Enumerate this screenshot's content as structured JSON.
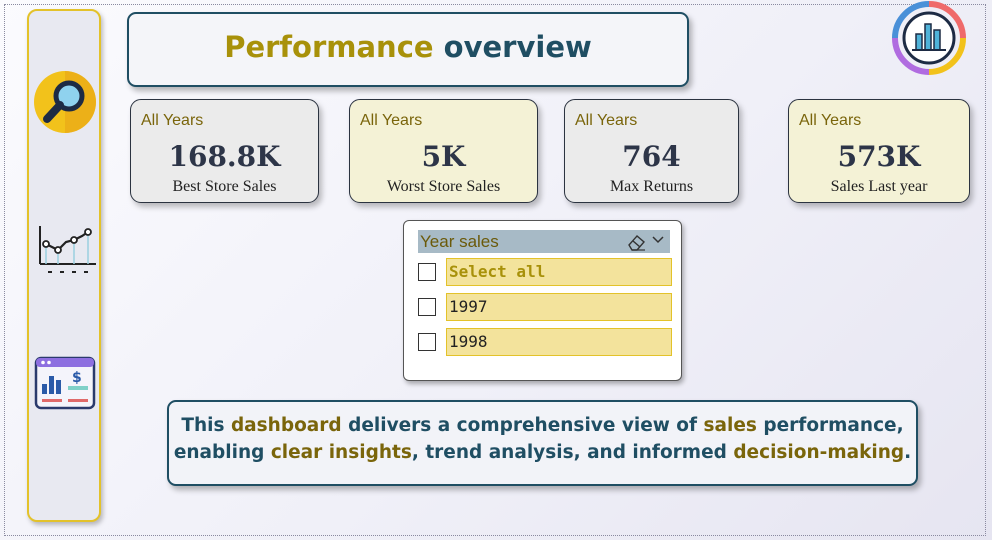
{
  "title": {
    "part1": "Performance",
    "part2": "overview"
  },
  "sidebar": {
    "items": [
      {
        "name": "search",
        "icon": "magnifier-icon"
      },
      {
        "name": "trend",
        "icon": "trend-chart-icon"
      },
      {
        "name": "dashboard",
        "icon": "dashboard-icon"
      }
    ]
  },
  "logo": {
    "icon": "analytics-logo-icon"
  },
  "kpis": [
    {
      "label": "All Years",
      "value": "168.8K",
      "caption": "Best Store Sales",
      "style": "grey"
    },
    {
      "label": "All Years",
      "value": "5K",
      "caption": "Worst Store Sales",
      "style": "cream"
    },
    {
      "label": "All Years",
      "value": "764",
      "caption": "Max Returns",
      "style": "grey"
    },
    {
      "label": "All Years",
      "value": "573K",
      "caption": "Sales Last year",
      "style": "cream"
    }
  ],
  "slicer": {
    "title": "Year sales",
    "options": [
      {
        "label": "Select all",
        "checked": false
      },
      {
        "label": "1997",
        "checked": false
      },
      {
        "label": "1998",
        "checked": false
      }
    ]
  },
  "description": {
    "line1": [
      {
        "text": "This ",
        "hl": false
      },
      {
        "text": "dashboard",
        "hl": true
      },
      {
        "text": " delivers a comprehensive view of ",
        "hl": false
      },
      {
        "text": "sales",
        "hl": true
      },
      {
        "text": " performance,",
        "hl": false
      }
    ],
    "line2": [
      {
        "text": "enabling ",
        "hl": false
      },
      {
        "text": "clear insights",
        "hl": true
      },
      {
        "text": ", trend analysis, and informed ",
        "hl": false
      },
      {
        "text": "decision-making",
        "hl": true
      },
      {
        "text": ".",
        "hl": false
      }
    ]
  },
  "colors": {
    "gold": "#a8910a",
    "teal": "#1f4e63",
    "accent": "#e3c22a"
  }
}
